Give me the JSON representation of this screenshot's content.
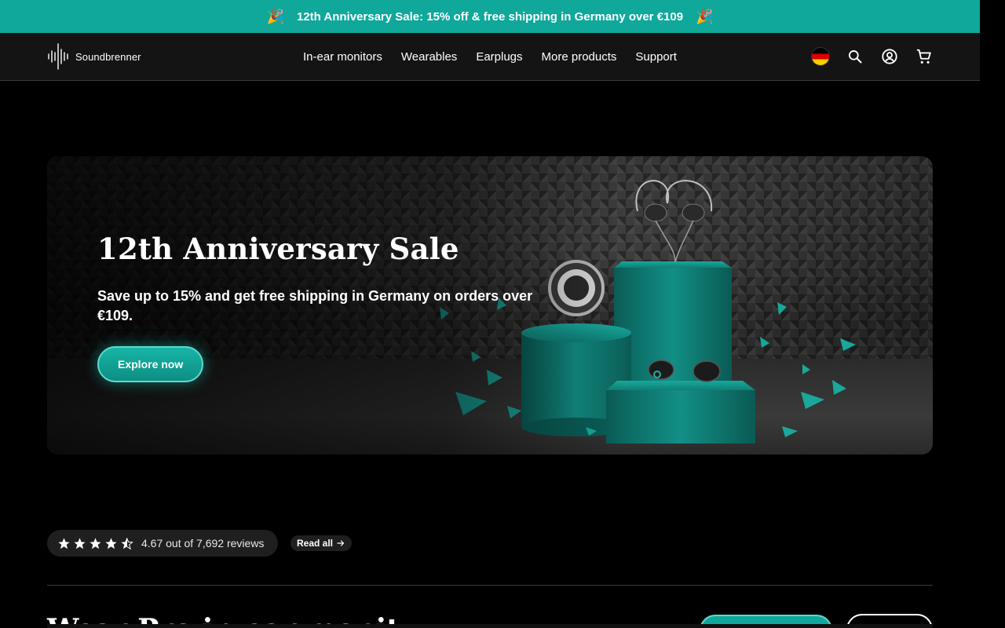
{
  "announcement": {
    "emoji_left": "🎉",
    "text": "12th Anniversary Sale: 15% off & free shipping in Germany over €109",
    "emoji_right": "🎉",
    "background": "#0fa89b"
  },
  "header": {
    "logo_text": "Soundbrenner",
    "nav": [
      "In-ear monitors",
      "Wearables",
      "Earplugs",
      "More products",
      "Support"
    ],
    "icons": [
      "germany-flag-icon",
      "search-icon",
      "account-icon",
      "cart-icon"
    ]
  },
  "hero": {
    "title": "12th Anniversary Sale",
    "subtitle": "Save up to 15% and get free shipping in Germany on orders over €109.",
    "cta_label": "Explore now",
    "accent": "#14b3a5"
  },
  "reviews": {
    "rating": 4.67,
    "stars_shown": 4.5,
    "text": "4.67 out of 7,692 reviews",
    "read_all_label": "Read all"
  },
  "next_section": {
    "heading_partial": "Wear Pro in-ear monit"
  }
}
